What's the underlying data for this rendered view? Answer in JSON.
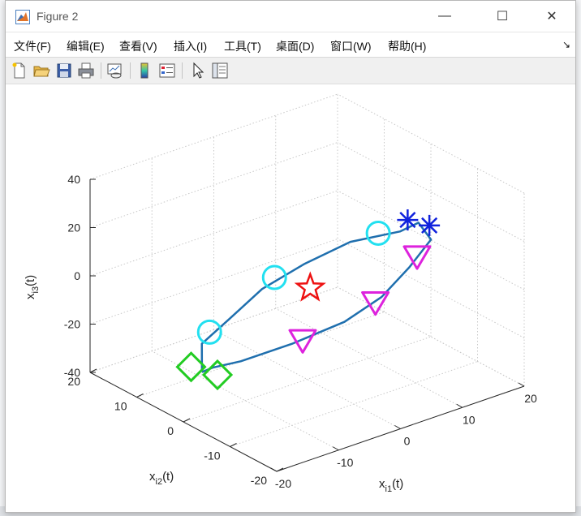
{
  "window": {
    "title": "Figure 2"
  },
  "window_controls": {
    "minimize": "—",
    "maximize": "☐",
    "close": "✕"
  },
  "menu": {
    "items": [
      "文件(F)",
      "编辑(E)",
      "查看(V)",
      "插入(I)",
      "工具(T)",
      "桌面(D)",
      "窗口(W)",
      "帮助(H)"
    ],
    "overflow_icon": "dock-arrow-icon"
  },
  "toolbar": {
    "buttons": [
      "new-figure-icon",
      "open-file-icon",
      "save-icon",
      "print-icon",
      "link-plot-icon",
      "colorbar-icon",
      "legend-icon",
      "pointer-icon",
      "property-inspector-icon"
    ]
  },
  "colors": {
    "line": "#1f6fae",
    "circle": "#22e0f0",
    "triangle": "#dd22dd",
    "diamond": "#22cc22",
    "star": "#ee1111",
    "asterisk": "#1122dd"
  },
  "chart_data": {
    "type": "line3d",
    "xlabel": "x_{i1}(t)",
    "ylabel": "x_{i2}(t)",
    "zlabel": "x_{i3}(t)",
    "xlim": [
      -20,
      20
    ],
    "ylim": [
      -20,
      20
    ],
    "zlim": [
      -40,
      40
    ],
    "x_ticks": [
      "-20",
      "-10",
      "0",
      "10",
      "20"
    ],
    "y_ticks": [
      "-20",
      "-10",
      "0",
      "10",
      "20"
    ],
    "z_ticks": [
      "-40",
      "-20",
      "0",
      "20",
      "40"
    ],
    "grid": true,
    "trajectory": [
      {
        "x": -17,
        "y": 0,
        "z": -22
      },
      {
        "x": -14,
        "y": 4,
        "z": -17
      },
      {
        "x": -8,
        "y": 6,
        "z": -14
      },
      {
        "x": -2,
        "y": 7,
        "z": -8
      },
      {
        "x": 4,
        "y": 6,
        "z": -2
      },
      {
        "x": 10,
        "y": 4,
        "z": 4
      },
      {
        "x": 15,
        "y": 0,
        "z": 8
      },
      {
        "x": 18,
        "y": 0,
        "z": 9
      },
      {
        "x": 17,
        "y": -4,
        "z": 7
      },
      {
        "x": 12,
        "y": -6,
        "z": 2
      },
      {
        "x": 6,
        "y": -8,
        "z": -3
      },
      {
        "x": 0,
        "y": -8,
        "z": -8
      },
      {
        "x": -7,
        "y": -6,
        "z": -13
      },
      {
        "x": -13,
        "y": -3,
        "z": -18
      },
      {
        "x": -16,
        "y": -1,
        "z": -20
      },
      {
        "x": -17,
        "y": 0,
        "z": -22
      }
    ],
    "markers": [
      {
        "shape": "circle",
        "x": -12,
        "y": 5,
        "z": -15
      },
      {
        "shape": "circle",
        "x": 0,
        "y": 7,
        "z": -5
      },
      {
        "shape": "circle",
        "x": 13,
        "y": 2,
        "z": 7
      },
      {
        "shape": "triangle",
        "x": -6,
        "y": -7,
        "z": -11
      },
      {
        "shape": "triangle",
        "x": 5,
        "y": -8,
        "z": -4
      },
      {
        "shape": "triangle",
        "x": 14,
        "y": -5,
        "z": 4
      },
      {
        "shape": "diamond",
        "x": -18,
        "y": 1,
        "z": -20
      },
      {
        "shape": "diamond",
        "x": -16,
        "y": -2,
        "z": -22
      },
      {
        "shape": "star",
        "x": 2,
        "y": 2,
        "z": -6
      },
      {
        "shape": "asterisk",
        "x": 17,
        "y": 1,
        "z": 10
      },
      {
        "shape": "asterisk",
        "x": 19,
        "y": -1,
        "z": 8
      }
    ]
  }
}
